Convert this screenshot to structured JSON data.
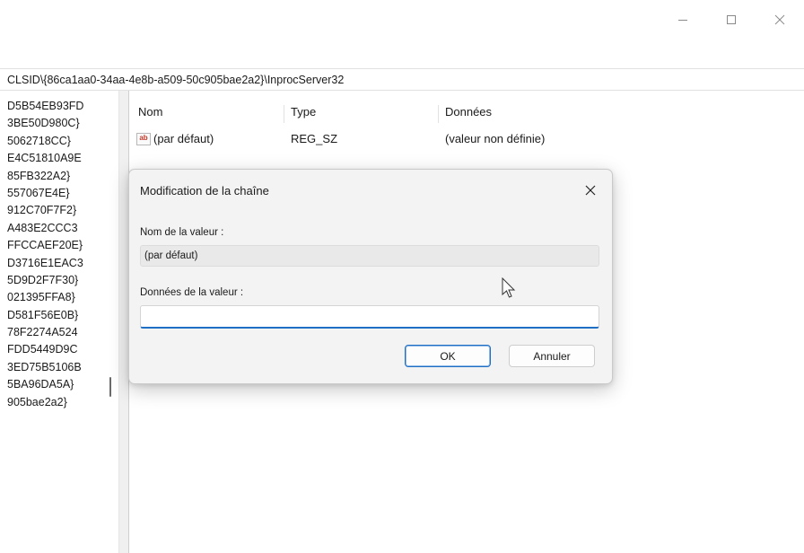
{
  "window_controls": {
    "minimize": "–",
    "maximize": "☐",
    "close": "✕"
  },
  "address_bar": {
    "path": "CLSID\\{86ca1aa0-34aa-4e8b-a509-50c905bae2a2}\\InprocServer32"
  },
  "tree": {
    "items": [
      "D5B54EB93FD",
      "3BE50D980C}",
      "5062718CC}",
      "E4C51810A9E",
      "85FB322A2}",
      "557067E4E}",
      "912C70F7F2}",
      "A483E2CCC3",
      "FFCCAEF20E}",
      "D3716E1EAC3",
      "5D9D2F7F30}",
      "021395FFA8}",
      "D581F56E0B}",
      "78F2274A524",
      "FDD5449D9C",
      "3ED75B5106B",
      "5BA96DA5A}",
      "905bae2a2}"
    ]
  },
  "values": {
    "columns": {
      "name": "Nom",
      "type": "Type",
      "data": "Données"
    },
    "rows": [
      {
        "icon": "ab",
        "name": "(par défaut)",
        "type": "REG_SZ",
        "data": "(valeur non définie)"
      }
    ]
  },
  "dialog": {
    "title": "Modification de la chaîne",
    "close": "✕",
    "name_label": "Nom de la valeur :",
    "name_value": "(par défaut)",
    "data_label": "Données de la valeur :",
    "data_value": "",
    "ok_label": "OK",
    "cancel_label": "Annuler"
  },
  "colors": {
    "accent": "#1f6fc5",
    "reg_icon": "#c0392b",
    "dialog_bg": "#f3f3f3"
  }
}
